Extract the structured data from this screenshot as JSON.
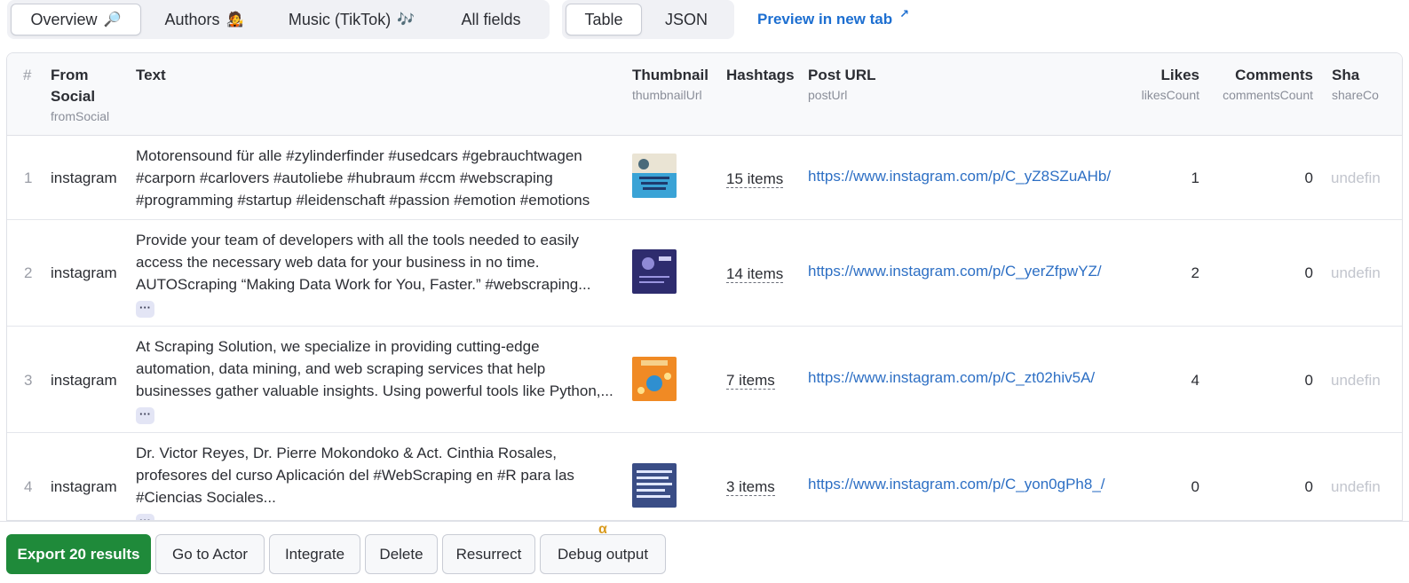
{
  "tabs": {
    "view": [
      {
        "label": "Overview",
        "emoji": "🔎",
        "active": true
      },
      {
        "label": "Authors",
        "emoji": "🧑‍🎤",
        "active": false
      },
      {
        "label": "Music (TikTok)",
        "emoji": "🎶",
        "active": false
      },
      {
        "label": "All fields",
        "emoji": "",
        "active": false
      }
    ],
    "format": [
      {
        "label": "Table",
        "active": true
      },
      {
        "label": "JSON",
        "active": false
      }
    ],
    "preview_label": "Preview in new tab",
    "preview_icon": "external-link-icon"
  },
  "table": {
    "columns": {
      "index": "#",
      "from_social": {
        "label": "From Social",
        "key": "fromSocial"
      },
      "text": {
        "label": "Text"
      },
      "thumbnail": {
        "label": "Thumbnail",
        "key": "thumbnailUrl"
      },
      "hashtags": {
        "label": "Hashtags"
      },
      "post_url": {
        "label": "Post URL",
        "key": "postUrl"
      },
      "likes": {
        "label": "Likes",
        "key": "likesCount"
      },
      "comments": {
        "label": "Comments",
        "key": "commentsCount"
      },
      "shares": {
        "label": "Sha",
        "key": "shareCo"
      }
    },
    "more_label": "···",
    "rows": [
      {
        "index": "1",
        "from_social": "instagram",
        "text": "Motorensound für alle #zylinderfinder #usedcars #gebrauchtwagen #carporn #carlovers #autoliebe #hubraum #ccm #webscraping #programming #startup #leidenschaft #passion #emotion #emotions",
        "hashtags": "15 items",
        "post_url": "https://www.instagram.com/p/C_yZ8SZuAHb/",
        "likes": "1",
        "comments": "0",
        "shares": "undefin",
        "has_more": false
      },
      {
        "index": "2",
        "from_social": "instagram",
        "text": "Provide your team of developers with all the tools needed to easily access the necessary web data for your business in no time. AUTOScraping “Making Data Work for You, Faster.” #webscraping...",
        "hashtags": "14 items",
        "post_url": "https://www.instagram.com/p/C_yerZfpwYZ/",
        "likes": "2",
        "comments": "0",
        "shares": "undefin",
        "has_more": true
      },
      {
        "index": "3",
        "from_social": "instagram",
        "text": "At Scraping Solution, we specialize in providing cutting-edge automation, data mining, and web scraping services that help businesses gather valuable insights. Using powerful tools like Python,...",
        "hashtags": "7 items",
        "post_url": "https://www.instagram.com/p/C_zt02hiv5A/",
        "likes": "4",
        "comments": "0",
        "shares": "undefin",
        "has_more": true
      },
      {
        "index": "4",
        "from_social": "instagram",
        "text": "Dr. Victor Reyes, Dr. Pierre Mokondoko & Act. Cinthia Rosales, profesores del curso Aplicación del #WebScraping en #R para las #Ciencias Sociales...",
        "hashtags": "3 items",
        "post_url": "https://www.instagram.com/p/C_yon0gPh8_/",
        "likes": "0",
        "comments": "0",
        "shares": "undefin",
        "has_more": true
      }
    ]
  },
  "footer": {
    "export_label": "Export 20 results",
    "go_to_actor_label": "Go to Actor",
    "integrate_label": "Integrate",
    "delete_label": "Delete",
    "resurrect_label": "Resurrect",
    "debug_label": "Debug output",
    "alpha_badge": "α"
  },
  "colors": {
    "accent": "#1d6fd1",
    "export_green": "#1f8a3a",
    "alpha": "#d99b1f"
  }
}
